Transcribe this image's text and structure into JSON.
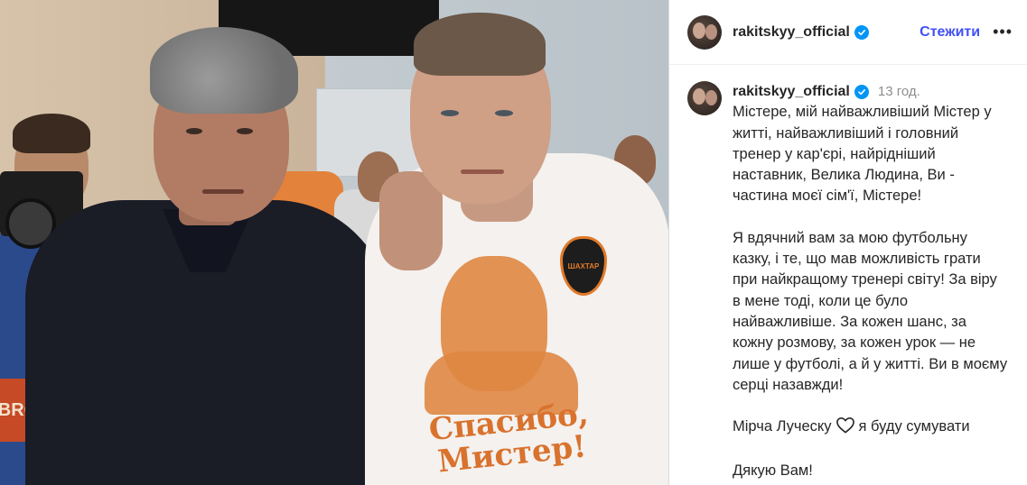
{
  "post": {
    "username": "rakitskyy_official",
    "follow_label": "Стежити",
    "more_label": "•••",
    "time": "13 год.",
    "caption": {
      "p1": "Містере, мій найважливіший Містер у житті, найважливіший і головний тренер у кар'єрі, найрідніший наставник, Велика Людина, Ви - частина моєї сім'ї, Містере!",
      "p2": "Я вдячний вам за мою футбольну казку, і те, що мав можливість грати при найкращому тренері світу! За віру в мене тоді, коли це було найважливіше. За кожен шанс, за кожну розмову, за кожен урок — не лише у футболі, а й у житті. Ви в моєму серці назавжди!",
      "p3_before": "Мірча Луческу",
      "p3_after": "я буду сумувати",
      "p4": "Дякую Вам!"
    }
  },
  "photo": {
    "shirt_print": "Спасибо, Мистер!",
    "sign_text": "BRO",
    "badge_text": "ШАХТАР"
  },
  "icons": {
    "verified": "verified-badge-icon",
    "heart": "heart-outline-icon",
    "more": "more-dots-icon"
  },
  "colors": {
    "verified": "#0095f6",
    "follow": "#4150f7",
    "muted": "#8e8e8e"
  }
}
